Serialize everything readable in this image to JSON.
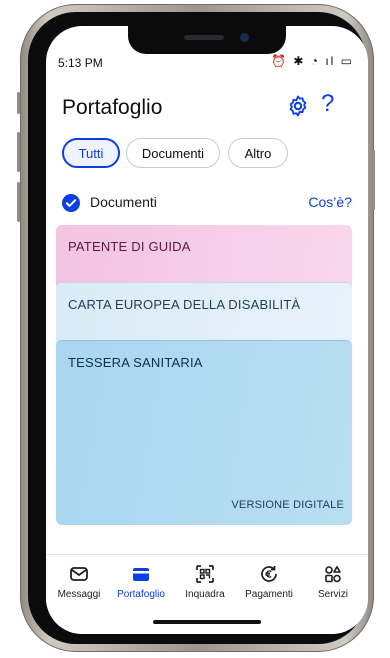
{
  "status_bar": {
    "time": "5:13 PM",
    "icons": "⏰ ✱ ◔ ıl ▭"
  },
  "header": {
    "title": "Portafoglio"
  },
  "filters": {
    "items": [
      "Tutti",
      "Documenti",
      "Altro"
    ],
    "active": "Tutti"
  },
  "section": {
    "label": "Documenti",
    "link": "Cos’è?"
  },
  "cards": [
    {
      "name": "PATENTE DI GUIDA"
    },
    {
      "name": "CARTA EUROPEA DELLA DISABILITÀ"
    },
    {
      "name": "TESSERA SANITARIA",
      "badge": "VERSIONE DIGITALE"
    }
  ],
  "tabbar": {
    "items": [
      "Messaggi",
      "Portafoglio",
      "Inquadra",
      "Pagamenti",
      "Servizi"
    ],
    "active": "Portafoglio"
  },
  "colors": {
    "accent": "#0b3ee3",
    "card_pink": "#f3c3e2",
    "card_light_blue": "#d9ebf7",
    "card_blue": "#a9d6f0"
  }
}
